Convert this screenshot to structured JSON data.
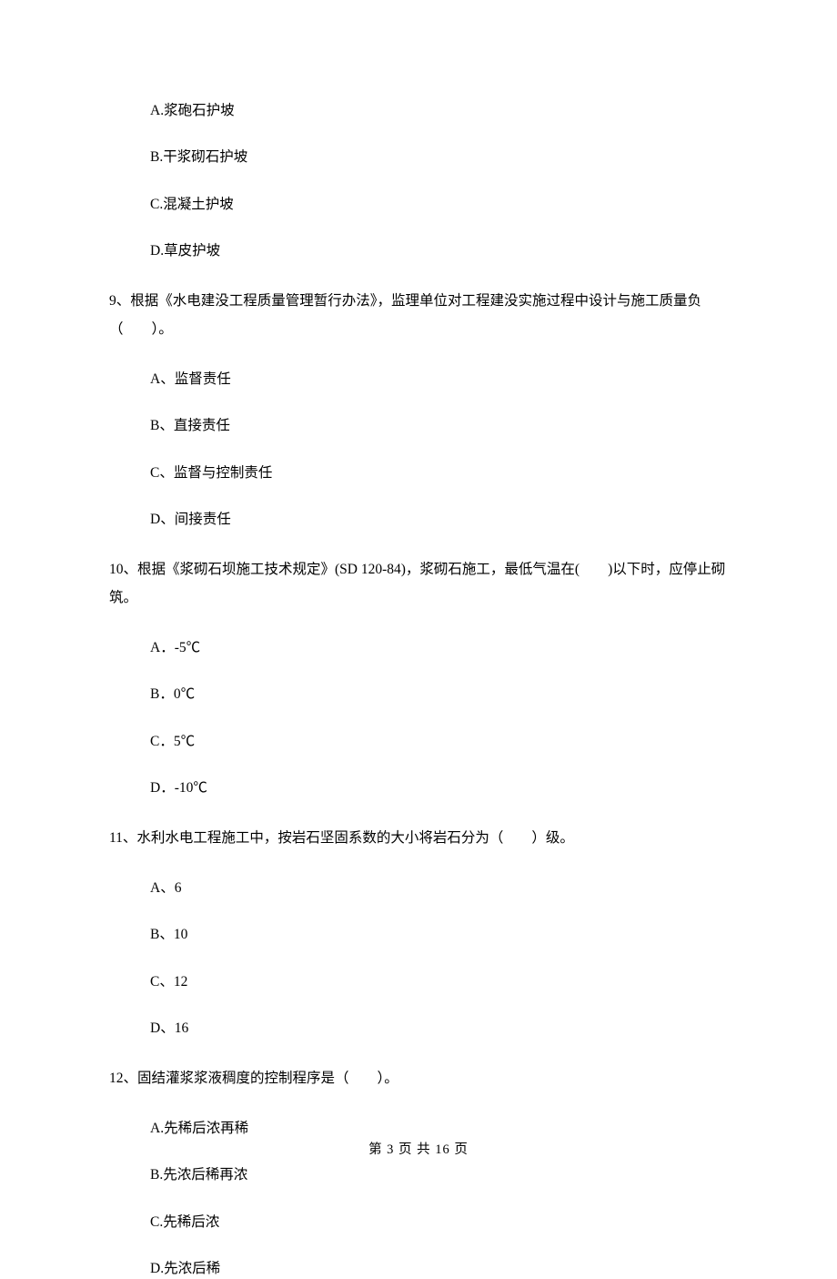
{
  "q8_options": {
    "a": "A.浆砲石护坡",
    "b": "B.干浆砌石护坡",
    "c": "C.混凝土护坡",
    "d": "D.草皮护坡"
  },
  "q9": {
    "text": "9、根据《水电建没工程质量管理暂行办法》，监理单位对工程建没实施过程中设计与施工质量负（　　）。",
    "a": "A、监督责任",
    "b": "B、直接责任",
    "c": "C、监督与控制责任",
    "d": "D、间接责任"
  },
  "q10": {
    "text": "10、根据《浆砌石坝施工技术规定》(SD 120-84)，浆砌石施工，最低气温在(　　)以下时，应停止砌筑。",
    "a": "A．-5℃",
    "b": "B．0℃",
    "c": "C．5℃",
    "d": "D．-10℃"
  },
  "q11": {
    "text": "11、水利水电工程施工中，按岩石坚固系数的大小将岩石分为（　　）级。",
    "a": "A、6",
    "b": "B、10",
    "c": "C、12",
    "d": "D、16"
  },
  "q12": {
    "text": "12、固结灌浆浆液稠度的控制程序是（　　）。",
    "a": "A.先稀后浓再稀",
    "b": "B.先浓后稀再浓",
    "c": "C.先稀后浓",
    "d": "D.先浓后稀"
  },
  "footer": "第 3 页 共 16 页"
}
